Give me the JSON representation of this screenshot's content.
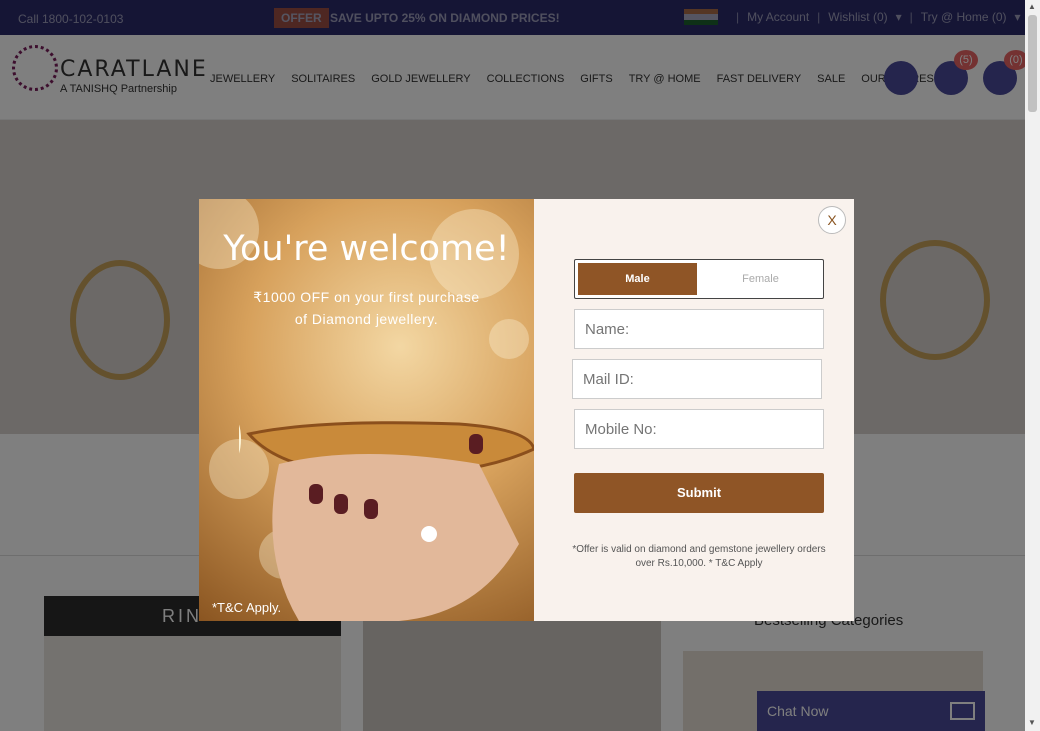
{
  "topbar": {
    "call": "Call 1800-102-0103",
    "offer_tag": "OFFER",
    "offer_text": "SAVE UPTO 25% ON DIAMOND PRICES!",
    "my_account": "My Account",
    "wishlist": "Wishlist (0)",
    "try_home": "Try @ Home (0)"
  },
  "header": {
    "logo_word": "CARATLANE",
    "logo_sub": "A TANISHQ Partnership",
    "nav": [
      "JEWELLERY",
      "SOLITAIRES",
      "GOLD JEWELLERY",
      "COLLECTIONS",
      "GIFTS",
      "TRY @ HOME",
      "FAST DELIVERY",
      "SALE",
      "OUR STORES"
    ],
    "notif_count": "(5)",
    "cart_count": "(0)"
  },
  "page": {
    "rings_label": "RIN",
    "bestselling": "Bestselling Categories",
    "chat": "Chat Now"
  },
  "modal": {
    "title": "You're welcome!",
    "offer_line1": "₹1000 OFF on your first purchase",
    "offer_line2": "of Diamond jewellery.",
    "tc": "*T&C Apply.",
    "close": "X",
    "male": "Male",
    "female": "Female",
    "name_placeholder": "Name:",
    "mail_placeholder": "Mail ID:",
    "mobile_placeholder": "Mobile No:",
    "submit": "Submit",
    "disclaimer": "*Offer is valid on diamond and gemstone jewellery orders over Rs.10,000. * T&C Apply"
  },
  "colors": {
    "topbar": "#2b2b6b",
    "accent_brown": "#8f5526",
    "modal_bg": "#f9f2ed"
  }
}
